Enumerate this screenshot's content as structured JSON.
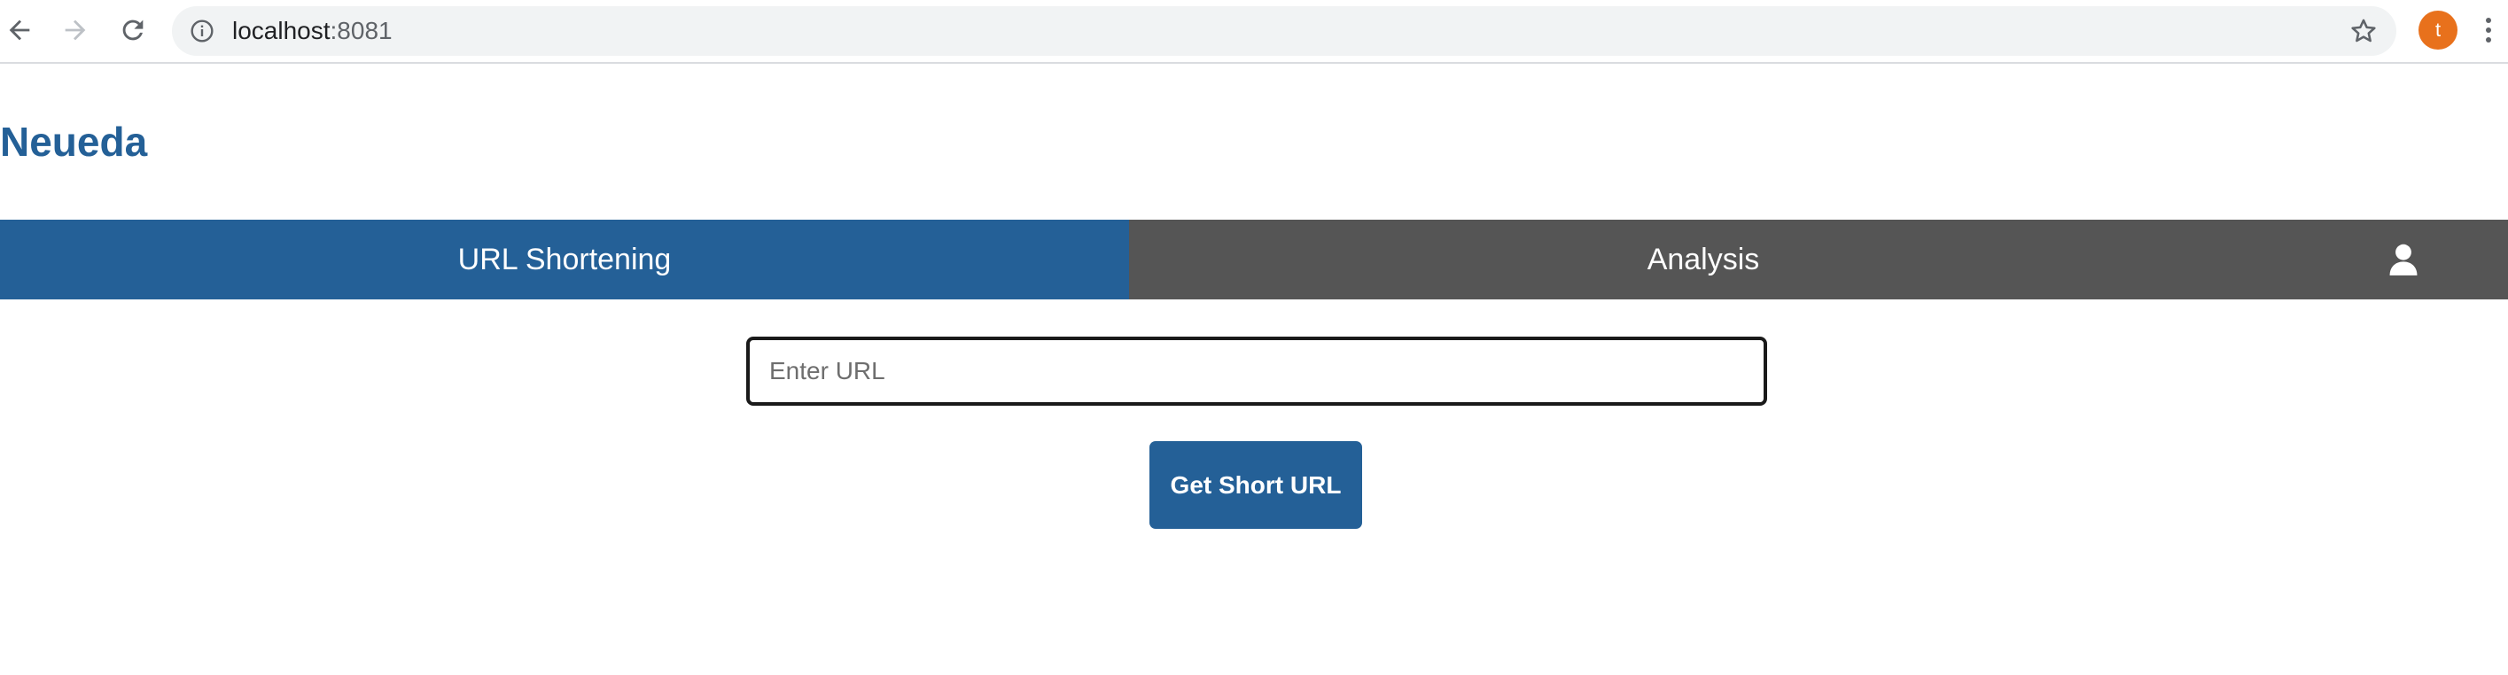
{
  "browser": {
    "url_host": "localhost",
    "url_port": ":8081",
    "profile_initial": "t",
    "profile_color": "#e8711c",
    "icons": [
      "back-arrow-icon",
      "forward-arrow-icon",
      "reload-icon",
      "info-icon",
      "star-icon",
      "more-vert-icon"
    ]
  },
  "page": {
    "brand": "Neueda",
    "brand_color": "#246097"
  },
  "navbar": {
    "tabs": [
      {
        "label": "URL Shortening",
        "active": true
      },
      {
        "label": "Analysis",
        "active": false
      }
    ],
    "active_color": "#246097",
    "bar_color": "#555555",
    "user_icon": "user-icon"
  },
  "form": {
    "url_value": "",
    "url_placeholder": "Enter URL",
    "submit_label": "Get Short URL"
  }
}
